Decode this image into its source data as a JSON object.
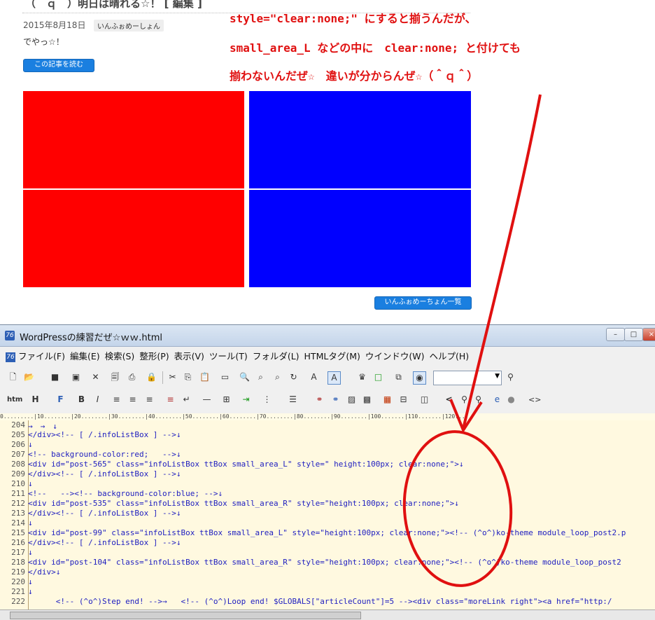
{
  "blog": {
    "title": "（＾ｑ＾）明日は晴れる☆！ [ 編集 ]",
    "date": "2015年8月18日",
    "category": "いんふぉめーしょん",
    "excerpt": "でやっ☆！",
    "read_more": "この記事を読む",
    "list_button": "いんふぉめーちょん一覧"
  },
  "annotation": {
    "line1": "style=\"clear:none;\" にすると揃うんだが、",
    "line2": "small_area_L などの中に　clear:none; と付けても",
    "line3": "揃わないんだぜ☆　違いが分からんぜ☆（＾ｑ＾）"
  },
  "colors": {
    "red_box": "#ff0000",
    "blue_box": "#0000ff",
    "annotation": "#e01010"
  },
  "editor": {
    "window_title": "WordPressの練習だぜ☆ｗｗ.html",
    "menu": [
      "ファイル(F)",
      "編集(E)",
      "検索(S)",
      "整形(P)",
      "表示(V)",
      "ツール(T)",
      "フォルダ(L)",
      "HTMLタグ(M)",
      "ウインドウ(W)",
      "ヘルプ(H)"
    ],
    "ruler": "0.........|10........|20........|30........|40........|50........|60........|70........|80........|90........|100.......|110.......|120....",
    "lines": [
      {
        "num": "204",
        "text": "→　→　↓"
      },
      {
        "num": "205",
        "text": "</div><!-- [ /.infoListBox ] -->↓"
      },
      {
        "num": "206",
        "text": "↓"
      },
      {
        "num": "207",
        "text": "<!-- background-color:red;   -->↓"
      },
      {
        "num": "208",
        "text": "<div id=\"post-565\" class=\"infoListBox ttBox small_area_L\" style=\" height:100px; clear:none;\">↓"
      },
      {
        "num": "209",
        "text": "</div><!-- [ /.infoListBox ] -->↓"
      },
      {
        "num": "210",
        "text": "↓"
      },
      {
        "num": "211",
        "text": "<!--   --><!-- background-color:blue; -->↓"
      },
      {
        "num": "212",
        "text": "<div id=\"post-535\" class=\"infoListBox ttBox small_area_R\" style=\"height:100px; clear:none;\">↓"
      },
      {
        "num": "213",
        "text": "</div><!-- [ /.infoListBox ] -->↓"
      },
      {
        "num": "214",
        "text": "↓"
      },
      {
        "num": "215",
        "text": "<div id=\"post-99\" class=\"infoListBox ttBox small_area_L\" style=\"height:100px; clear:none;\"><!-- (^o^)ko-theme module_loop_post2.p"
      },
      {
        "num": "216",
        "text": "</div><!-- [ /.infoListBox ] -->↓"
      },
      {
        "num": "217",
        "text": "↓"
      },
      {
        "num": "218",
        "text": "<div id=\"post-104\" class=\"infoListBox ttBox small_area_R\" style=\"height:100px; clear:none;\"><!-- (^o^)ko-theme module_loop_post2"
      },
      {
        "num": "219",
        "text": "</div>↓"
      },
      {
        "num": "220",
        "text": "↓"
      },
      {
        "num": "221",
        "text": "↓"
      },
      {
        "num": "222",
        "text": "      <!-- (^o^)Step end! -->→   <!-- (^o^)Loop end! $GLOBALS[\"articleCount\"]=5 --><div class=\"moreLink right\"><a href=\"http:/"
      }
    ]
  }
}
